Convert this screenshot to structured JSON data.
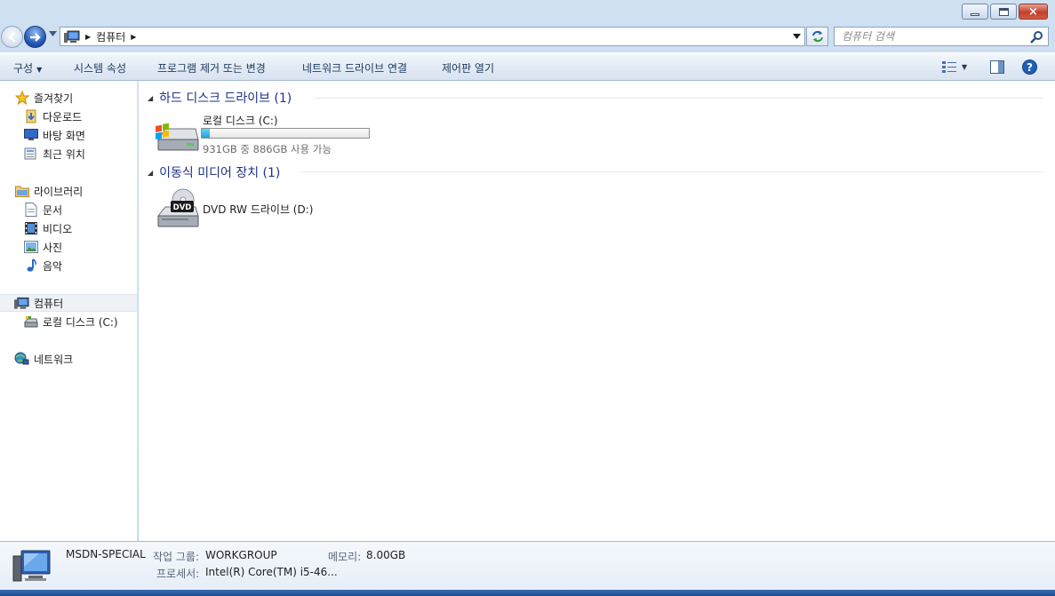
{
  "window": {
    "controls": {
      "minimize": "minimize",
      "maximize": "maximize",
      "close": "×"
    }
  },
  "address": {
    "segment": "컴퓨터",
    "search_placeholder": "컴퓨터 검색"
  },
  "toolbar": {
    "organize": "구성",
    "system_properties": "시스템 속성",
    "uninstall": "프로그램 제거 또는 변경",
    "map_drive": "네트워크 드라이브 연결",
    "control_panel": "제어판 열기"
  },
  "nav": {
    "favorites": {
      "label": "즐겨찾기",
      "items": [
        "다운로드",
        "바탕 화면",
        "최근 위치"
      ]
    },
    "libraries": {
      "label": "라이브러리",
      "items": [
        "문서",
        "비디오",
        "사진",
        "음악"
      ]
    },
    "computer": {
      "label": "컴퓨터",
      "items": [
        "로컬 디스크 (C:)"
      ]
    },
    "network": {
      "label": "네트워크"
    }
  },
  "content": {
    "groups": [
      {
        "title": "하드 디스크 드라이브 (1)",
        "drive": {
          "name": "로컬 디스크 (C:)",
          "free_text": "931GB 중 886GB 사용 가능",
          "used_fraction": 0.048
        }
      },
      {
        "title": "이동식 미디어 장치 (1)",
        "drive": {
          "name": "DVD RW 드라이브 (D:)",
          "icon_text": "DVD"
        }
      }
    ]
  },
  "details": {
    "computer_name": "MSDN-SPECIAL",
    "workgroup_label": "작업 그룹:",
    "workgroup": "WORKGROUP",
    "memory_label": "메모리:",
    "memory": "8.00GB",
    "processor_label": "프로세서:",
    "processor": "Intel(R) Core(TM) i5-46..."
  },
  "colors": {
    "title_bg": "#c5d7ea",
    "group_header": "#1e3287",
    "bar_fill": "#26a0da"
  }
}
